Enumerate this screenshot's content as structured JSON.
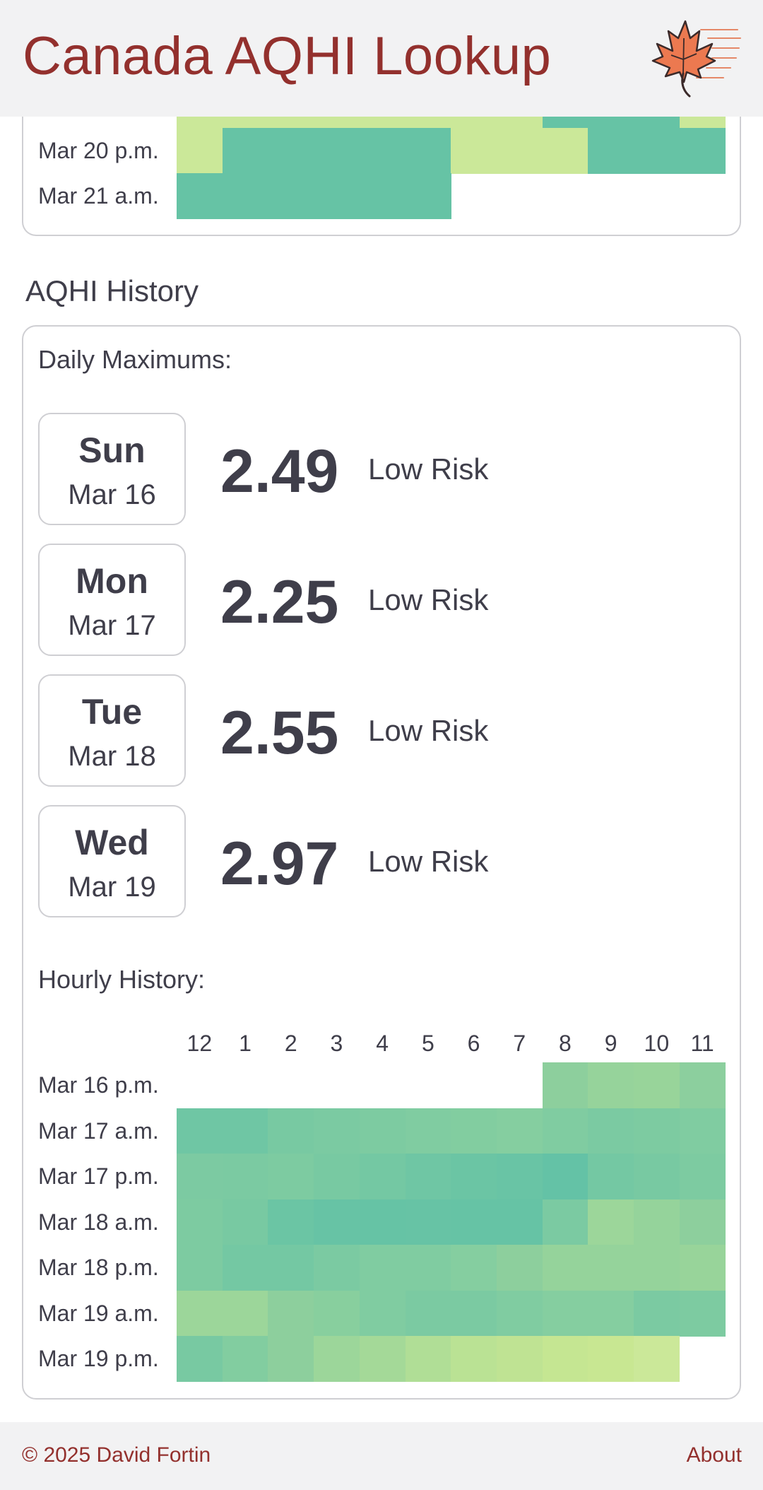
{
  "header": {
    "title": "Canada AQHI Lookup",
    "logo_icon": "maple-leaf-icon"
  },
  "forecast": {
    "rows": [
      {
        "label": "",
        "cells": [
          "#cbe899",
          "#cbe899",
          "#cbe899",
          "#cbe899",
          "#cbe899",
          "#cbe899",
          "#cbe899",
          "#cbe899",
          "#66c3a5",
          "#66c3a5",
          "#66c3a5",
          "#cbe899"
        ]
      },
      {
        "label": "Mar 20 p.m.",
        "cells": [
          "#cbe899",
          "#66c3a5",
          "#66c3a5",
          "#66c3a5",
          "#66c3a5",
          "#664c3a5",
          "#cbe899",
          "#cbe899",
          "#cbe899",
          "#66c3a5",
          "#66c3a5",
          "#66c3a5"
        ]
      },
      {
        "label": "Mar 21 a.m.",
        "cells": [
          "#66c3a5",
          "#66c3a5",
          "#66c3a5",
          "#66c3a5",
          "#66c3a5",
          "#66c3a5",
          null,
          null,
          null,
          null,
          null,
          null
        ]
      }
    ]
  },
  "history": {
    "section_title": "AQHI History",
    "daily_title": "Daily Maximums:",
    "daily": [
      {
        "day": "Sun",
        "date": "Mar 16",
        "value": "2.49",
        "risk": "Low Risk"
      },
      {
        "day": "Mon",
        "date": "Mar 17",
        "value": "2.25",
        "risk": "Low Risk"
      },
      {
        "day": "Tue",
        "date": "Mar 18",
        "value": "2.55",
        "risk": "Low Risk"
      },
      {
        "day": "Wed",
        "date": "Mar 19",
        "value": "2.97",
        "risk": "Low Risk"
      }
    ],
    "hourly_title": "Hourly History:",
    "hours": [
      "12",
      "1",
      "2",
      "3",
      "4",
      "5",
      "6",
      "7",
      "8",
      "9",
      "10",
      "11"
    ],
    "rows": [
      {
        "label": "Mar 16 p.m.",
        "cells": [
          null,
          null,
          null,
          null,
          null,
          null,
          null,
          null,
          "#8dcf9d",
          "#96d39b",
          "#98d49a",
          "#8ccf9e"
        ]
      },
      {
        "label": "Mar 17 a.m.",
        "cells": [
          "#6fc6a4",
          "#6fc6a4",
          "#78c9a2",
          "#7bcaa2",
          "#7dcba1",
          "#80cca1",
          "#82cda0",
          "#85cea0",
          "#80cca1",
          "#7bcaa2",
          "#7dcba1",
          "#80cca1"
        ]
      },
      {
        "label": "Mar 17 p.m.",
        "cells": [
          "#7ccaa2",
          "#7bcaa2",
          "#7dcba1",
          "#78c9a2",
          "#74c8a3",
          "#6fc6a4",
          "#6bc5a4",
          "#69c4a5",
          "#64c2a6",
          "#74c8a3",
          "#78c9a2",
          "#7dcba1"
        ]
      },
      {
        "label": "Mar 18 a.m.",
        "cells": [
          "#7dcba1",
          "#78c9a2",
          "#6bc5a4",
          "#67c3a5",
          "#66c3a5",
          "#67c3a5",
          "#66c3a5",
          "#66c3a5",
          "#7bcaa2",
          "#9cd69a",
          "#95d39b",
          "#8dcf9d"
        ]
      },
      {
        "label": "Mar 18 p.m.",
        "cells": [
          "#7dcba1",
          "#74c8a3",
          "#74c8a3",
          "#7bcaa2",
          "#80cca1",
          "#80cca1",
          "#85cea0",
          "#8dcf9d",
          "#95d39b",
          "#95d39b",
          "#95d39b",
          "#98d49a"
        ]
      },
      {
        "label": "Mar 19 a.m.",
        "cells": [
          "#9cd69a",
          "#9cd69a",
          "#8dcf9d",
          "#88cf9e",
          "#80cca1",
          "#7bcaa2",
          "#7bcaa2",
          "#80cca1",
          "#85cea0",
          "#85cea0",
          "#7bcaa2",
          "#7dcba1"
        ]
      },
      {
        "label": "Mar 19 p.m.",
        "cells": [
          "#78c9a2",
          "#82cda0",
          "#8dcf9d",
          "#9cd69a",
          "#a4d998",
          "#b0de96",
          "#bae294",
          "#bfe393",
          "#c5e692",
          "#c8e792",
          "#cbe899",
          null
        ]
      }
    ]
  },
  "footer": {
    "copyright": "© 2025 David Fortin",
    "about": "About"
  }
}
